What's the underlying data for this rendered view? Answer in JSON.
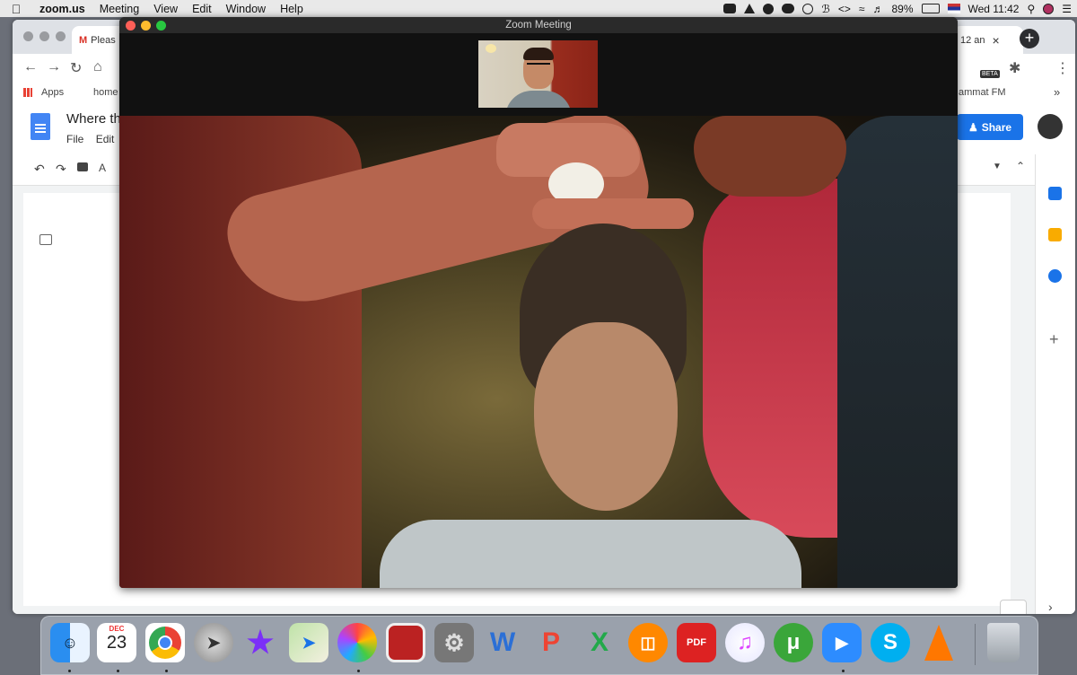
{
  "menubar": {
    "app": "zoom.us",
    "items": [
      "Meeting",
      "View",
      "Edit",
      "Window",
      "Help"
    ],
    "battery": "89%",
    "clock": "Wed 11:42"
  },
  "browser": {
    "tab_left": "Pleas",
    "tab_right": "12 an",
    "bookmarks": {
      "apps": "Apps",
      "home": "home",
      "right": "ammat FM"
    },
    "beta_badge": "BETA"
  },
  "docs": {
    "title": "Where th",
    "menu": [
      "File",
      "Edit"
    ],
    "share_label": "Share"
  },
  "zoom": {
    "window_title": "Zoom Meeting"
  },
  "colors": {
    "share": "#1a73e8",
    "close": "#fe5f57",
    "minimize": "#febc2e",
    "zoom": "#28c840"
  },
  "dock": {
    "calendar_month": "DEC",
    "calendar_day": "23",
    "apps": [
      "finder",
      "calendar",
      "chrome",
      "launchpad",
      "imovie",
      "maps",
      "photos",
      "photo-booth",
      "system-preferences",
      "word",
      "powerpoint",
      "excel",
      "books",
      "pdf",
      "itunes",
      "utorrent",
      "zoom",
      "skype",
      "vlc",
      "trash"
    ]
  }
}
